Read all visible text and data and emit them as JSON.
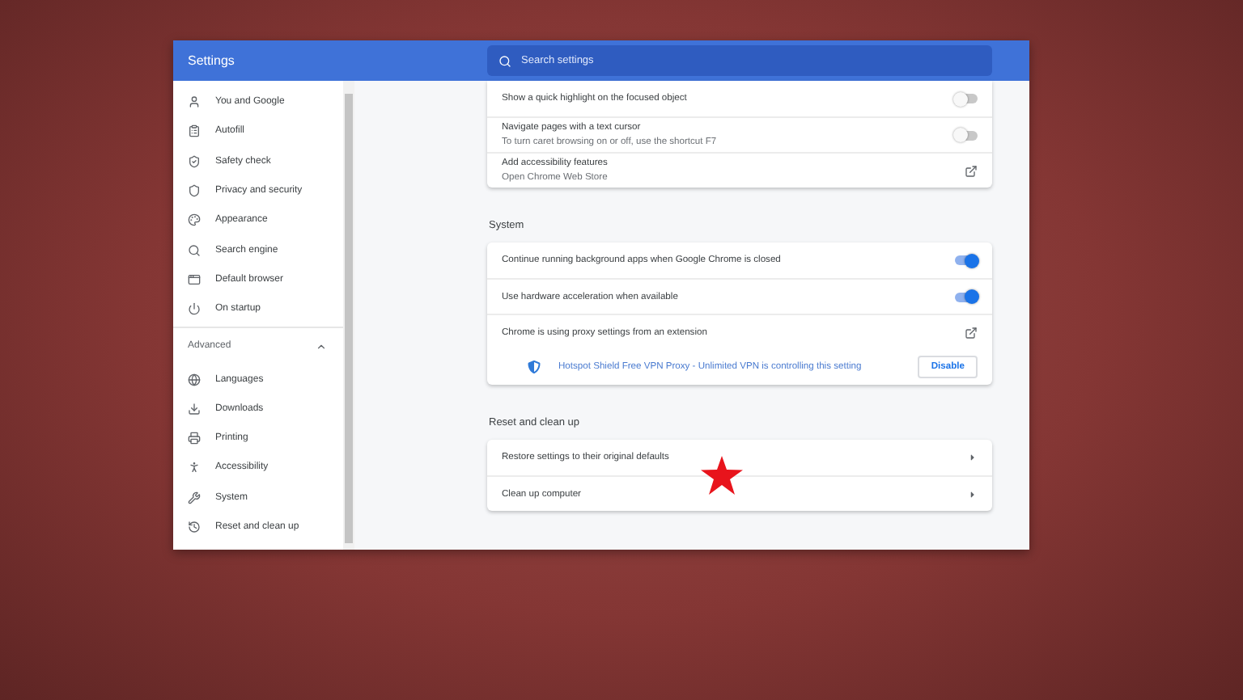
{
  "header": {
    "title": "Settings",
    "search": {
      "placeholder": "Search settings"
    }
  },
  "sidebar": {
    "items": [
      {
        "label": "You and Google"
      },
      {
        "label": "Autofill"
      },
      {
        "label": "Safety check"
      },
      {
        "label": "Privacy and security"
      },
      {
        "label": "Appearance"
      },
      {
        "label": "Search engine"
      },
      {
        "label": "Default browser"
      },
      {
        "label": "On startup"
      }
    ],
    "advanced": {
      "label": "Advanced",
      "expanded": true
    },
    "advanced_items": [
      {
        "label": "Languages"
      },
      {
        "label": "Downloads"
      },
      {
        "label": "Printing"
      },
      {
        "label": "Accessibility"
      },
      {
        "label": "System"
      },
      {
        "label": "Reset and clean up"
      }
    ]
  },
  "sections": [
    {
      "rows": [
        {
          "kind": "toggle",
          "label": "Show a quick highlight on the focused object",
          "on": false
        },
        {
          "kind": "toggle",
          "label": "Navigate pages with a text cursor",
          "subtitle": "To turn caret browsing on or off, use the shortcut F7",
          "on": false
        },
        {
          "kind": "external",
          "label": "Add accessibility features",
          "subtitle": "Open Chrome Web Store"
        }
      ]
    },
    {
      "title": "System",
      "rows": [
        {
          "kind": "toggle",
          "label": "Continue running background apps when Google Chrome is closed",
          "on": true
        },
        {
          "kind": "toggle",
          "label": "Use hardware acceleration when available",
          "on": true
        },
        {
          "kind": "external",
          "label": "Chrome is using proxy settings from an extension"
        },
        {
          "kind": "notice",
          "label": "Hotspot Shield Free VPN Proxy - Unlimited VPN is controlling this setting",
          "button": "Disable"
        }
      ]
    },
    {
      "title": "Reset and clean up",
      "rows": [
        {
          "kind": "nav",
          "label": "Restore settings to their original defaults"
        },
        {
          "kind": "nav",
          "label": "Clean up computer"
        }
      ]
    }
  ]
}
